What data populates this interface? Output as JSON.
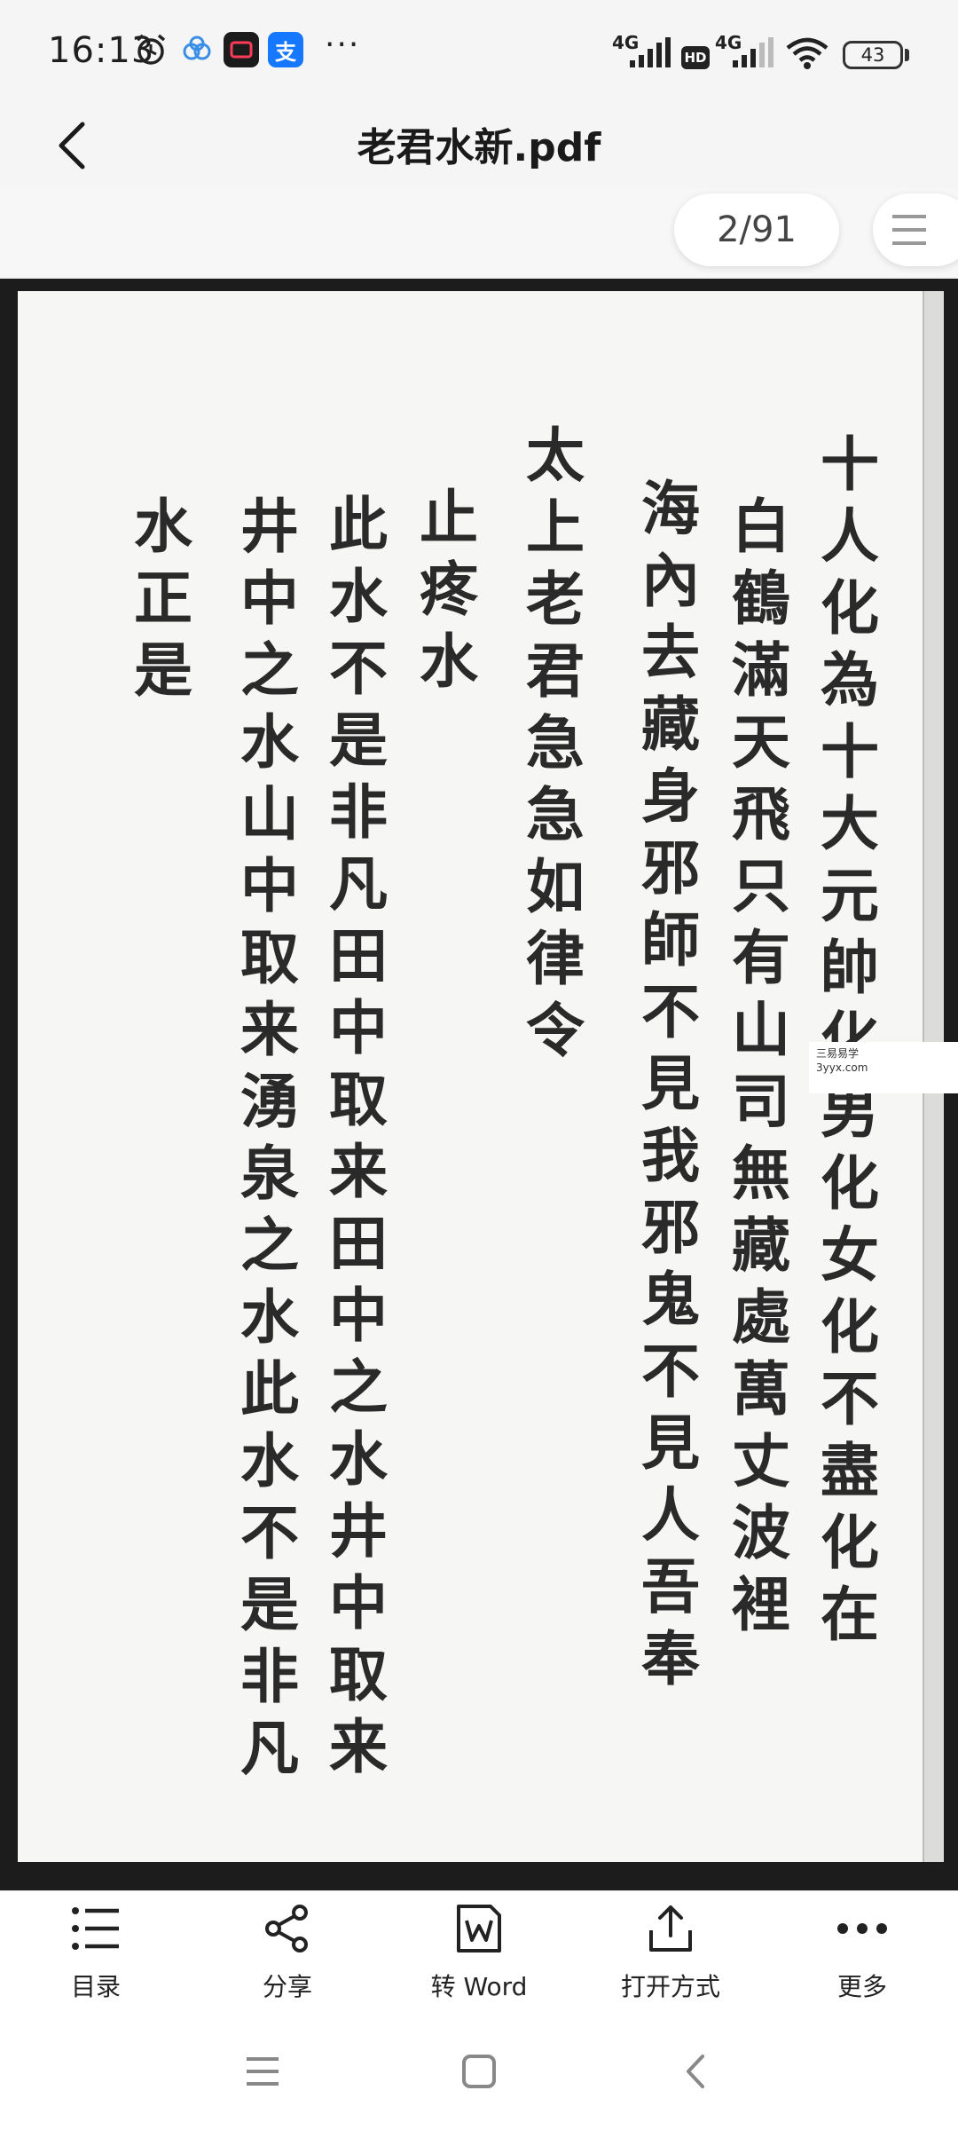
{
  "status_bar": {
    "time": "16:13",
    "network_1": "4G",
    "network_2": "4G",
    "hd": "HD",
    "battery": "43",
    "more_indicator": "···"
  },
  "header": {
    "title": "老君水新.pdf"
  },
  "viewer": {
    "page_indicator": "2/91"
  },
  "document": {
    "columns": [
      "十人化為十大元帥化男化女化不盡化在",
      "白鶴滿天飛只有山司無藏處萬丈波裡",
      "海內去藏身邪師不見我邪鬼不見人吾奉",
      "太上老君急急如律令",
      "止疼水",
      "此水不是非凡田中取来田中之水井中取来",
      "井中之水山中取来湧泉之水此水不是非凡",
      "水正是"
    ],
    "watermark_line1": "三易易学",
    "watermark_line2": "3yyx.com"
  },
  "toolbar": {
    "toc": "目录",
    "share": "分享",
    "to_word": "转 Word",
    "open_with": "打开方式",
    "more": "更多"
  }
}
